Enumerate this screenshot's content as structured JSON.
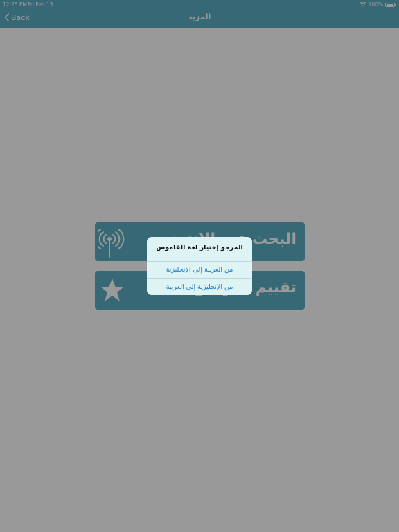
{
  "status_bar": {
    "time": "12:25 PM",
    "date": "Fri Feb 15",
    "battery": "100%"
  },
  "nav": {
    "back_label": "Back",
    "title": "المزيد"
  },
  "menu": {
    "items": [
      {
        "label": "البحث عبر الإنترنت",
        "icon": "antenna-icon"
      },
      {
        "label": "تقييم البرنامج",
        "icon": "star-icon"
      }
    ]
  },
  "dialog": {
    "title": "المرجو إختيار لغة القاموس",
    "actions": [
      {
        "label": "من العربية إلى الإنجليزية"
      },
      {
        "label": "من الإنجليزية إلى العربية"
      }
    ]
  },
  "colors": {
    "accent": "#5aaec4",
    "dialog_bg": "#ddf3f4",
    "action_text": "#1f79c4"
  }
}
